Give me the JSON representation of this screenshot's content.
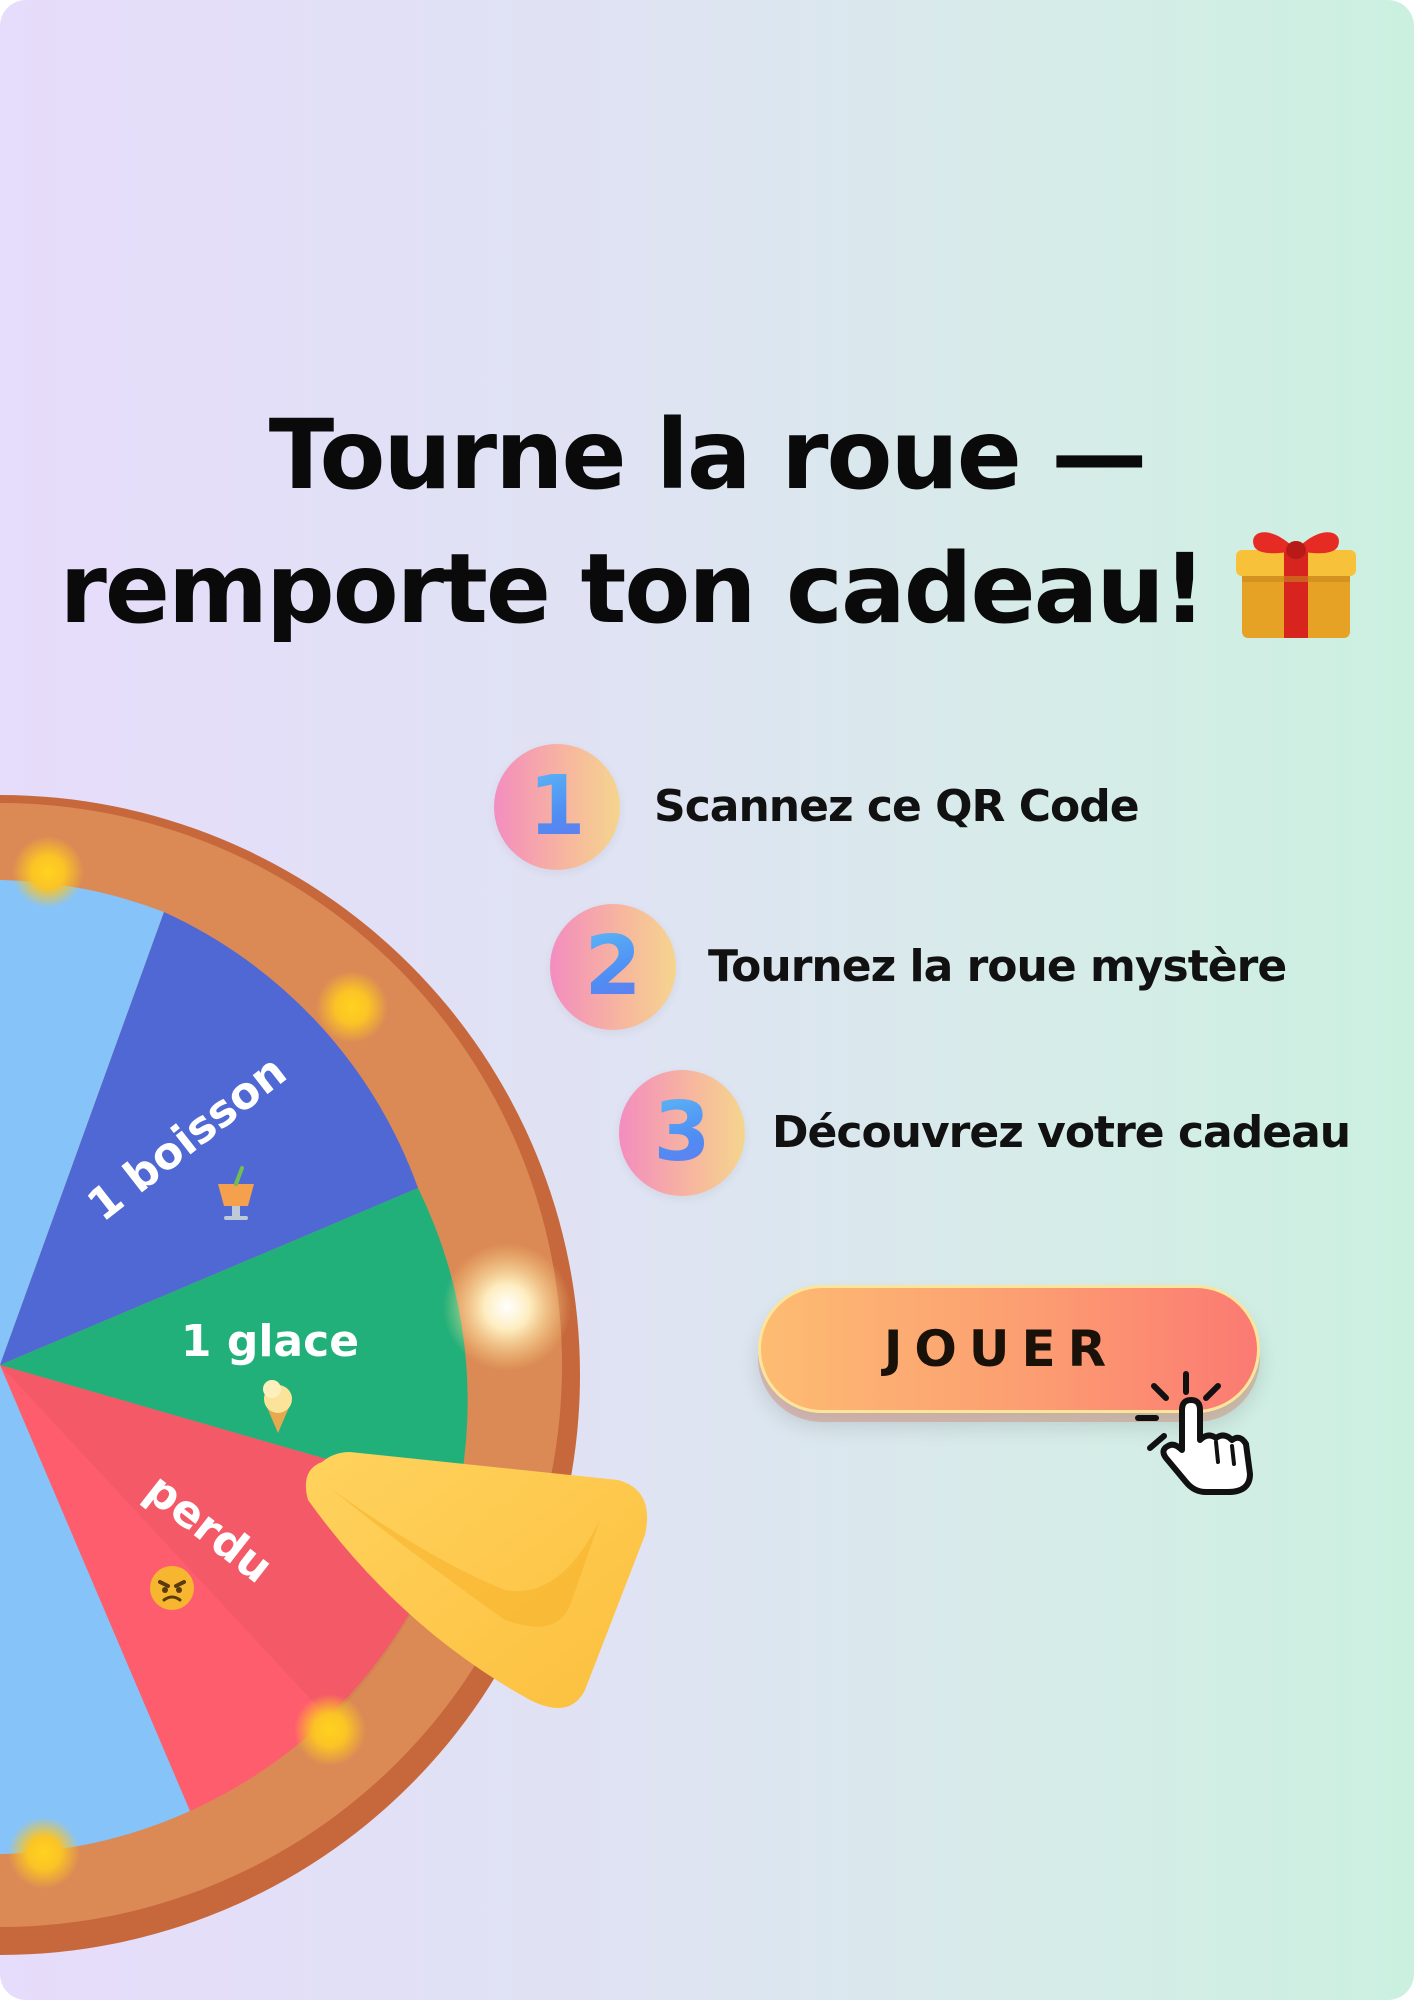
{
  "title": {
    "line1": "Tourne la roue —",
    "line2": "remporte ton cadeau!"
  },
  "steps": [
    {
      "number": "1",
      "label": "Scannez ce QR Code"
    },
    {
      "number": "2",
      "label": "Tournez la roue mystère"
    },
    {
      "number": "3",
      "label": "Découvrez votre cadeau"
    }
  ],
  "play_button": {
    "label": "JOUER"
  },
  "wheel": {
    "segments": [
      {
        "label": "1 boisson",
        "icon": "drink-icon",
        "color": "#5068d3"
      },
      {
        "label": "1 glace",
        "icon": "ice-cream-icon",
        "color": "#22b07a"
      },
      {
        "label": "perdu",
        "icon": "angry-face-icon",
        "color": "#fe5d6d"
      },
      {
        "label": "",
        "icon": "",
        "color": "#86c3f9"
      }
    ],
    "rim_color": "#db8a55",
    "pointer_color": "#fdc84f"
  },
  "icons": {
    "gift": "gift-icon",
    "cursor": "pointing-hand-click-icon"
  },
  "colors": {
    "background_start": "#e6dcfb",
    "background_end": "#cbf0e0",
    "button": "#fc9d72",
    "step_circle": "#f7b89d"
  }
}
